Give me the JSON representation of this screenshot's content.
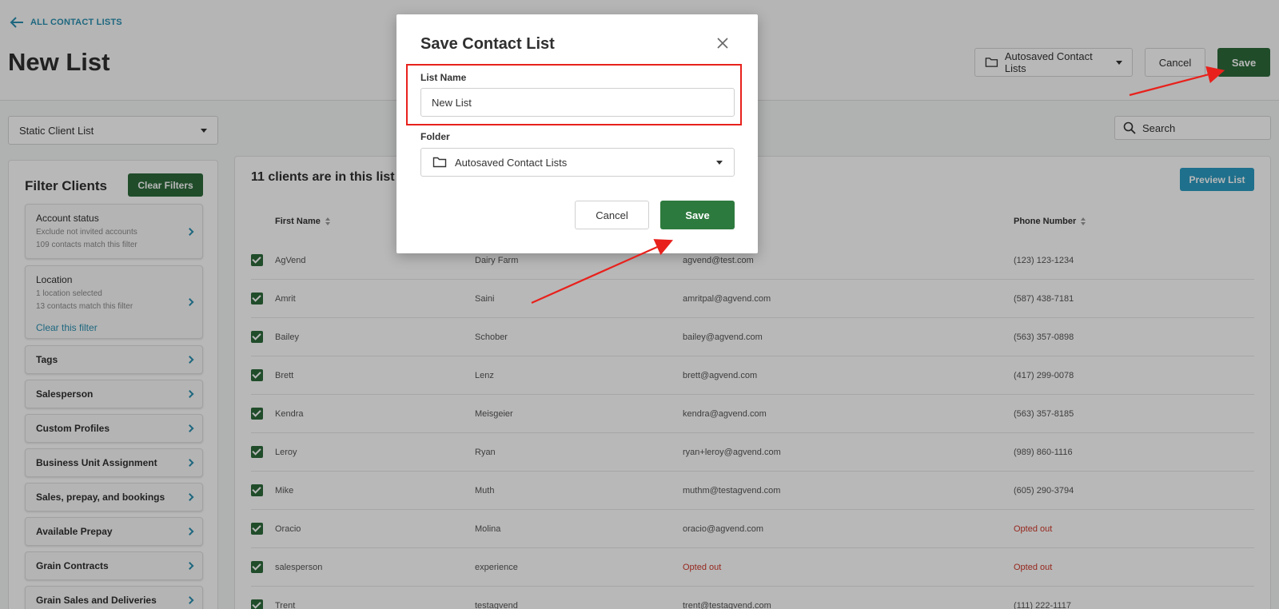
{
  "header": {
    "back_link": "ALL CONTACT LISTS",
    "page_title": "New List",
    "folder_select": "Autosaved Contact Lists",
    "cancel_label": "Cancel",
    "save_label": "Save"
  },
  "list_type": {
    "value": "Static Client List"
  },
  "search": {
    "placeholder": "Search"
  },
  "filters": {
    "title": "Filter Clients",
    "clear_label": "Clear Filters",
    "account_status": {
      "name": "Account status",
      "line1": "Exclude not invited accounts",
      "line2": "109 contacts match this filter"
    },
    "location": {
      "name": "Location",
      "line1": "1 location selected",
      "line2": "13 contacts match this filter",
      "clear_link": "Clear this filter"
    },
    "items": [
      "Tags",
      "Salesperson",
      "Custom Profiles",
      "Business Unit Assignment",
      "Sales, prepay, and bookings",
      "Available Prepay",
      "Grain Contracts",
      "Grain Sales and Deliveries"
    ]
  },
  "table": {
    "count_text": "11 clients are in this list",
    "preview_label": "Preview List",
    "columns": {
      "first_name": "First Name",
      "phone": "Phone Number"
    },
    "rows": [
      {
        "first": "AgVend",
        "last": "Dairy Farm",
        "email": "agvend@test.com",
        "phone": "(123) 123-1234"
      },
      {
        "first": "Amrit",
        "last": "Saini",
        "email": "amritpal@agvend.com",
        "phone": "(587) 438-7181"
      },
      {
        "first": "Bailey",
        "last": "Schober",
        "email": "bailey@agvend.com",
        "phone": "(563) 357-0898"
      },
      {
        "first": "Brett",
        "last": "Lenz",
        "email": "brett@agvend.com",
        "phone": "(417) 299-0078"
      },
      {
        "first": "Kendra",
        "last": "Meisgeier",
        "email": "kendra@agvend.com",
        "phone": "(563) 357-8185"
      },
      {
        "first": "Leroy",
        "last": "Ryan",
        "email": "ryan+leroy@agvend.com",
        "phone": "(989) 860-1116"
      },
      {
        "first": "Mike",
        "last": "Muth",
        "email": "muthm@testagvend.com",
        "phone": "(605) 290-3794"
      },
      {
        "first": "Oracio",
        "last": "Molina",
        "email": "oracio@agvend.com",
        "phone": "Opted out"
      },
      {
        "first": "salesperson",
        "last": "experience",
        "email": "Opted out",
        "phone": "Opted out"
      },
      {
        "first": "Trent",
        "last": "testagvend",
        "email": "trent@testagvend.com",
        "phone": "(111) 222-1117"
      }
    ]
  },
  "modal": {
    "title": "Save Contact List",
    "list_name_label": "List Name",
    "list_name_value": "New List",
    "folder_label": "Folder",
    "folder_value": "Autosaved Contact Lists",
    "cancel_label": "Cancel",
    "save_label": "Save"
  },
  "colors": {
    "primary_green": "#2d6a3b",
    "link_blue": "#2a8fb0",
    "preview_blue": "#2b9bc2",
    "opted_out_red": "#d0382b",
    "annotation_red": "#e8211c"
  }
}
